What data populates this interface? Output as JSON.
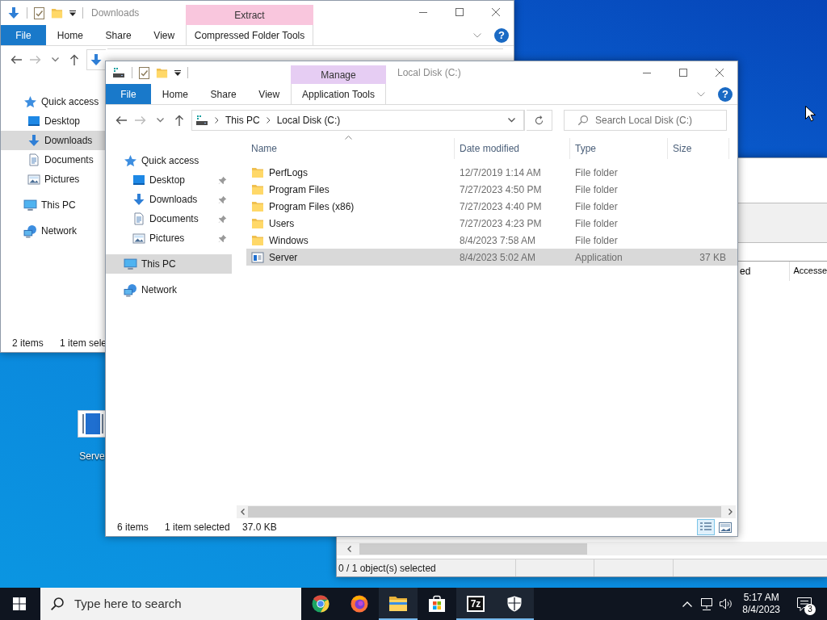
{
  "windows": [
    {
      "kind": "explorer",
      "title": "Downloads",
      "context_tab": "Extract",
      "context_group": "Compressed Folder Tools",
      "color": "#f9c6dd",
      "ribbon_tabs": [
        "File",
        "Home",
        "Share",
        "View"
      ],
      "help": "?",
      "address": {
        "kind": "download"
      },
      "nav": [
        {
          "kind": "star",
          "label": "Quick access",
          "selected": false,
          "children": [
            {
              "kind": "desktop",
              "label": "Desktop",
              "selected": false
            },
            {
              "kind": "download",
              "label": "Downloads",
              "selected": true
            },
            {
              "kind": "document",
              "label": "Documents",
              "selected": false
            },
            {
              "kind": "picture",
              "label": "Pictures",
              "selected": false
            }
          ]
        },
        {
          "kind": "pc",
          "label": "This PC",
          "selected": false
        },
        {
          "kind": "network",
          "label": "Network",
          "selected": false
        }
      ],
      "status": [
        "2 items",
        "1 item sele"
      ]
    },
    {
      "kind": "archive",
      "columns": [
        "ed",
        "Accesse"
      ],
      "status": "0 / 1 object(s) selected"
    },
    {
      "kind": "explorer",
      "title": "Local Disk (C:)",
      "context_tab": "Manage",
      "context_group": "Application Tools",
      "color": "#e6cdf3",
      "ribbon_tabs": [
        "File",
        "Home",
        "Share",
        "View"
      ],
      "help": "?",
      "address": {
        "kind": "drive",
        "crumbs": [
          "This PC",
          "Local Disk (C:)"
        ]
      },
      "search": {
        "placeholder": "Search Local Disk (C:)"
      },
      "nav": [
        {
          "kind": "star",
          "label": "Quick access",
          "selected": false,
          "children": [
            {
              "kind": "desktop",
              "label": "Desktop",
              "selected": false,
              "pinned": true
            },
            {
              "kind": "download",
              "label": "Downloads",
              "selected": false,
              "pinned": true
            },
            {
              "kind": "document",
              "label": "Documents",
              "selected": false,
              "pinned": true
            },
            {
              "kind": "picture",
              "label": "Pictures",
              "selected": false,
              "pinned": true
            }
          ]
        },
        {
          "kind": "pc",
          "label": "This PC",
          "selected": true
        },
        {
          "kind": "network",
          "label": "Network",
          "selected": false
        }
      ],
      "columns": [
        "Name",
        "Date modified",
        "Type",
        "Size"
      ],
      "files": [
        {
          "kind": "folder",
          "name": "PerfLogs",
          "date": "12/7/2019 1:14 AM",
          "type": "File folder",
          "selected": false
        },
        {
          "kind": "folder",
          "name": "Program Files",
          "date": "7/27/2023 4:50 PM",
          "type": "File folder",
          "selected": false
        },
        {
          "kind": "folder",
          "name": "Program Files (x86)",
          "date": "7/27/2023 4:40 PM",
          "type": "File folder",
          "selected": false
        },
        {
          "kind": "folder",
          "name": "Users",
          "date": "7/27/2023 4:23 PM",
          "type": "File folder",
          "selected": false
        },
        {
          "kind": "folder",
          "name": "Windows",
          "date": "8/4/2023 7:58 AM",
          "type": "File folder",
          "selected": false
        },
        {
          "kind": "app",
          "name": "Server",
          "date": "8/4/2023 5:02 AM",
          "type": "Application",
          "size": "37 KB",
          "selected": true
        }
      ],
      "status": [
        "6 items",
        "1 item selected",
        "37.0 KB"
      ]
    }
  ],
  "desktop_icons": [
    {
      "label": "Serve"
    }
  ],
  "taskbar": {
    "search": {
      "placeholder": "Type here to search"
    },
    "apps": [
      {
        "kind": "chrome",
        "running": false
      },
      {
        "kind": "firefox",
        "running": false
      },
      {
        "kind": "explorer",
        "running": true
      },
      {
        "kind": "store",
        "running": false
      },
      {
        "kind": "archiver",
        "label": "7z",
        "running": true
      },
      {
        "kind": "shield",
        "running": true
      }
    ],
    "clock": {
      "time": "5:17 AM",
      "date": "8/4/2023"
    },
    "notifications": "3"
  }
}
